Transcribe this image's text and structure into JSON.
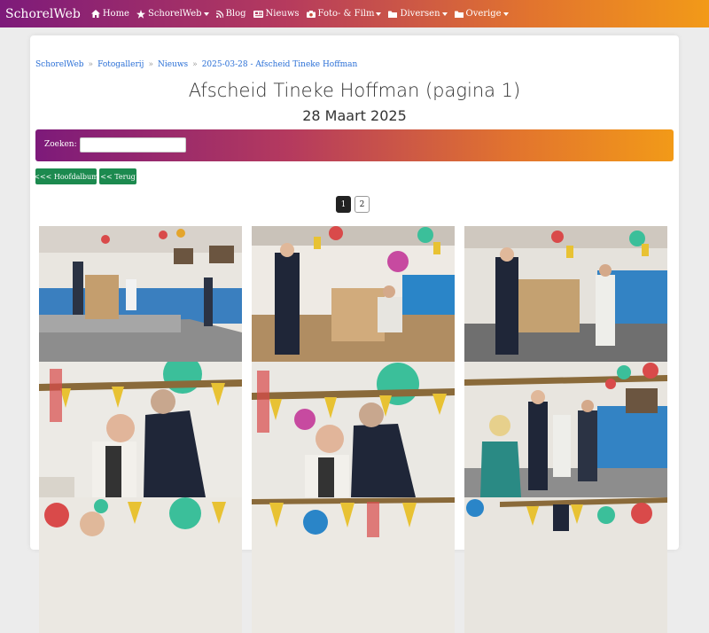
{
  "navbar": {
    "brand": "SchorelWeb",
    "items": [
      {
        "label": "Home",
        "icon": "home-icon",
        "dropdown": false
      },
      {
        "label": "SchorelWeb",
        "icon": "star-icon",
        "dropdown": true
      },
      {
        "label": "Blog",
        "icon": "rss-icon",
        "dropdown": false
      },
      {
        "label": "Nieuws",
        "icon": "newspaper-icon",
        "dropdown": false
      },
      {
        "label": "Foto- & Film",
        "icon": "camera-icon",
        "dropdown": true
      },
      {
        "label": "Diversen",
        "icon": "folder-icon",
        "dropdown": true
      },
      {
        "label": "Overige",
        "icon": "folder-icon",
        "dropdown": true
      }
    ]
  },
  "breadcrumb": [
    "SchorelWeb",
    "Fotogallerij",
    "Nieuws",
    "2025-03-28 - Afscheid Tineke Hoffman"
  ],
  "breadcrumb_sep": "»",
  "page": {
    "title": "Afscheid Tineke Hoffman (pagina 1)",
    "subtitle": "28 Maart 2025"
  },
  "search": {
    "label": "Zoeken:",
    "value": ""
  },
  "buttons": {
    "main_album": "<<< Hoofdalbum",
    "back": "<< Terug"
  },
  "pagination": {
    "current": "1",
    "next": "2"
  },
  "colors": {
    "gradient_start": "#7d1a7a",
    "gradient_end": "#f29a18",
    "button_green": "#1c8a4f",
    "link_blue": "#2a6fd6"
  }
}
